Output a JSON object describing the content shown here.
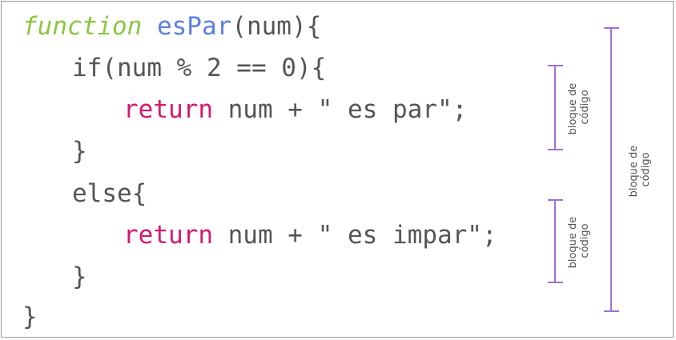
{
  "code": {
    "line1": {
      "keyword": "function",
      "space": " ",
      "name": "esPar",
      "rest": "(num){"
    },
    "line2": {
      "text": "if(num % 2 == 0){"
    },
    "line3": {
      "keyword": "return",
      "rest": " num + \" es par\";"
    },
    "line4": {
      "text": "}"
    },
    "line5": {
      "text": "else{"
    },
    "line6": {
      "keyword": "return",
      "rest": " num + \" es impar\";"
    },
    "line7": {
      "text": "}"
    },
    "line8": {
      "text": "}"
    }
  },
  "annotations": {
    "if_block": {
      "line1": "bloque de",
      "line2": "código"
    },
    "else_block": {
      "line1": "bloque de",
      "line2": "código"
    },
    "function_block": {
      "line1": "bloque de",
      "line2": "código"
    }
  },
  "colors": {
    "keyword_function": "#8cc63f",
    "function_name": "#5b7fe0",
    "keyword_return": "#d6196e",
    "plain_code": "#555555",
    "bracket": "#a070d8"
  }
}
